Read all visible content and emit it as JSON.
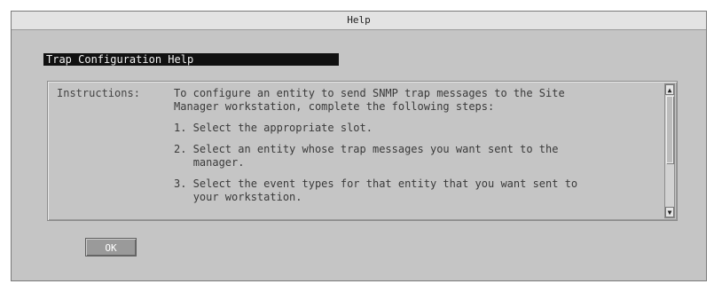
{
  "window": {
    "title": "Help"
  },
  "heading": "Trap Configuration Help",
  "panel": {
    "label": "Instructions:",
    "paragraphs": [
      "To configure an entity to send SNMP trap messages to the Site\nManager workstation, complete the following steps:",
      "1. Select the appropriate slot.",
      "2. Select an entity whose trap messages you want sent to the\n   manager.",
      "3. Select the event types for that entity that you want sent to\n   your workstation."
    ]
  },
  "scrollbar": {
    "up_icon": "▲",
    "down_icon": "▼"
  },
  "buttons": {
    "ok_label": "OK"
  }
}
